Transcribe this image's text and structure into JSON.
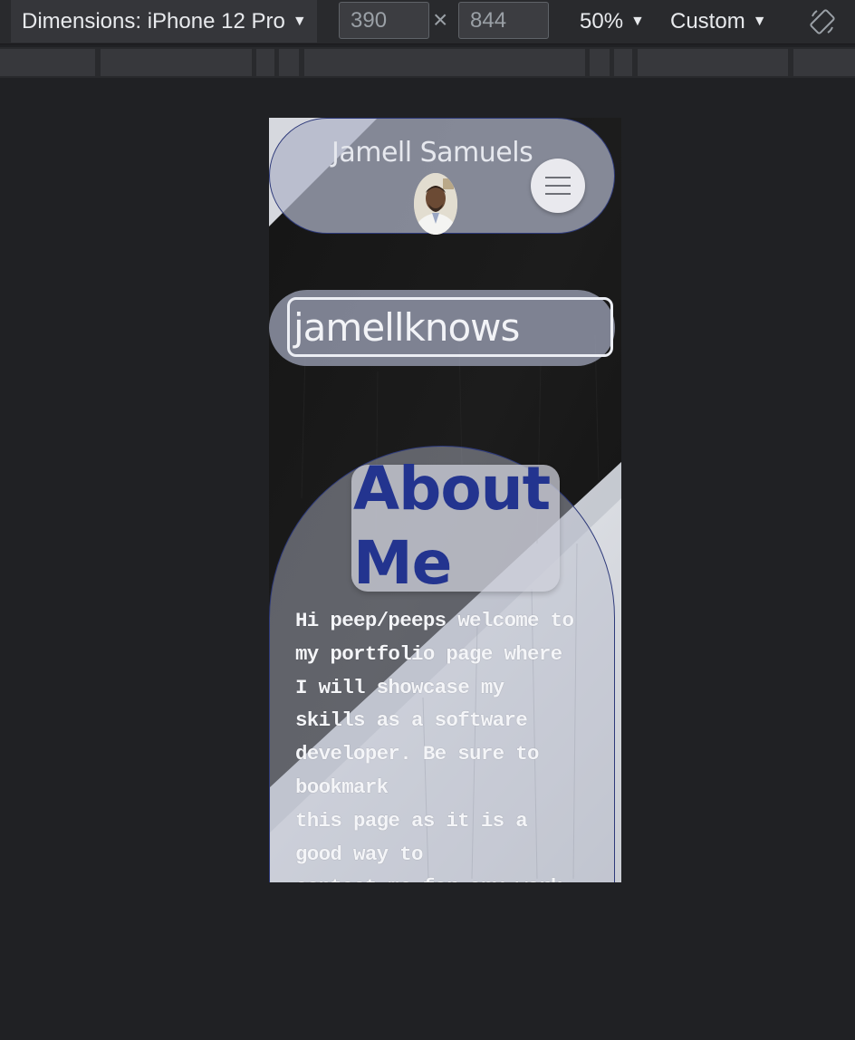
{
  "devtools": {
    "device_label": "Dimensions: iPhone 12 Pro",
    "width_value": "390",
    "height_value": "844",
    "times": "×",
    "zoom_label": "50%",
    "throttle_label": "Custom"
  },
  "site": {
    "name": "Jamell Samuels",
    "search_value": "jamellknows",
    "about": {
      "title": "About Me",
      "lines": [
        "Hi peep/peeps welcome to",
        "my portfolio page where",
        "I will showcase my",
        "skills as a software",
        "developer. Be sure to",
        "bookmark",
        "this page as it is a",
        "good way to",
        "contact me for any work"
      ]
    }
  },
  "colors": {
    "devtools_bg": "#202124",
    "toolbar_bg": "#292a2d",
    "accent_title": "#23348f",
    "pill_border": "#2e3a7a"
  },
  "icons": {
    "dropdown": "triangle-down",
    "menu": "hamburger",
    "rotate": "rotate-device"
  }
}
